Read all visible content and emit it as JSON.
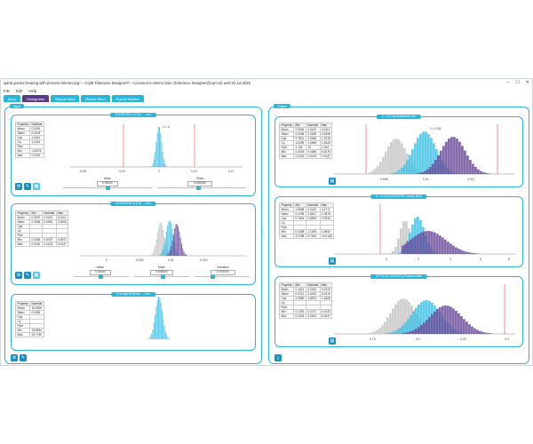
{
  "window": {
    "title": "spiral groove bearing with process tolerancing* – CQM Tolerance Designer® – Licensed to Demo User (Tolerance Designer@cqm.nl) until 31-12-2025",
    "controls": [
      "–",
      "☐",
      "✕"
    ]
  },
  "menu": [
    "File",
    "Edit",
    "Help"
  ],
  "tabs": [
    {
      "label": "Input",
      "active": false
    },
    {
      "label": "Histograms",
      "active": true
    },
    {
      "label": "Report Base",
      "active": false
    },
    {
      "label": "Report Elem",
      "active": false
    },
    {
      "label": "Export Studies",
      "active": false
    }
  ],
  "left": {
    "tag": "Input",
    "cards": [
      {
        "title": "ECCENTRIC (CTQ) ..... mm",
        "table": {
          "headers": [
            "Property",
            "Nominal"
          ],
          "rows": [
            [
              "Mean",
              "0.0000"
            ],
            [
              "Stdev",
              "0.0003"
            ],
            [
              "Cpk",
              "1.0411"
            ],
            [
              "Cp",
              "1.0421"
            ],
            [
              "Ppm",
              ""
            ],
            [
              "Min",
              "-0.0078"
            ],
            [
              "Max",
              "0.0024"
            ]
          ]
        },
        "ticks": [
          "-0.08",
          "-0.04",
          "0",
          "0.04",
          "0.11"
        ],
        "marker": "1 × σ",
        "sliders": [
          {
            "label": "Mean",
            "value": "0.00000"
          },
          {
            "label": "Stdev",
            "value": "0.000080"
          }
        ]
      },
      {
        "title": "ECCENTRIC B (TS) .... mm",
        "table": {
          "headers": [
            "Property",
            "Min",
            "Nominal",
            "Max"
          ],
          "rows": [
            [
              "Mean",
              "0.0097",
              "0.0100",
              "0.0111"
            ],
            [
              "Stdev",
              "0.0006",
              "0.0006",
              "0.0006"
            ],
            [
              "Cpk",
              "",
              "",
              ""
            ],
            [
              "Cp",
              "",
              "",
              ""
            ],
            [
              "Ppm",
              "",
              "",
              ""
            ],
            [
              "Min",
              "0.0053",
              "0.0075",
              "0.0097"
            ],
            [
              "Max",
              "0.0118",
              "0.0125",
              "0.0137"
            ]
          ]
        },
        "ticks": [
          "0",
          "0.005",
          "0.01",
          "0.015"
        ],
        "sliders": [
          {
            "label": "Mean",
            "value": "0.01000"
          },
          {
            "label": "Stdev",
            "value": "0.000600"
          },
          {
            "label": "Deviation",
            "value": "0.001000"
          }
        ]
      },
      {
        "title": "D (length B) (Max) ..... mm",
        "table": {
          "headers": [
            "Property",
            "Nominal"
          ],
          "rows": [
            [
              "Mean",
              "16.0000"
            ],
            [
              "Stdev",
              "0.0250"
            ],
            [
              "Cpk",
              ""
            ],
            [
              "Cp",
              ""
            ],
            [
              "Ppm",
              ""
            ],
            [
              "Min",
              "15.8934"
            ],
            [
              "Max",
              "16.7745"
            ]
          ]
        }
      }
    ]
  },
  "right": {
    "tag": "Output",
    "cards": [
      {
        "title": "Z = B (Gap dimension) mm",
        "marker": "1 × 0.05",
        "table": {
          "headers": [
            "Property",
            "Min",
            "Nominal",
            "Max"
          ],
          "rows": [
            [
              "Mean",
              "0.0082",
              "0.0100",
              "0.0113"
            ],
            [
              "Stdev",
              "0.0008",
              "0.0008",
              "0.0008"
            ],
            [
              "Cpk",
              "0.7811",
              "1.0468",
              "1.7615"
            ],
            [
              "Cp",
              "1.0035",
              "1.0998",
              "1.0540"
            ],
            [
              "Ppm",
              "1.134",
              "15",
              "1.044"
            ],
            [
              "Min",
              "0.0049",
              "0.0068",
              "0.0076"
            ],
            [
              "Max",
              "0.0115",
              "0.0133",
              "0.0147"
            ]
          ]
        },
        "ticks": [
          "0.008",
          "0.01",
          "0.012"
        ]
      },
      {
        "title": "D = B (D) ECCENTRIC (Outer) Bore",
        "table": {
          "headers": [
            "Property",
            "Min",
            "Nominal",
            "Max"
          ],
          "rows": [
            [
              "Mean",
              "1.8658",
              "2.0220",
              "4.2717"
            ],
            [
              "Stdev",
              "0.4798",
              "0.5617",
              "1.0878"
            ],
            [
              "Cpk",
              "0.7691",
              "0.8094",
              "0.7815"
            ],
            [
              "Cp",
              "",
              "",
              ""
            ],
            [
              "Ppm",
              "",
              "",
              ""
            ],
            [
              "Min",
              "0.4158",
              "1.1005",
              "1.8040"
            ],
            [
              "Max",
              "3.2788",
              "8.7054",
              "15.0138"
            ]
          ]
        },
        "ticks": [
          "0",
          "2",
          "4",
          "6",
          "8"
        ]
      },
      {
        "title": "LIFT B (ECCENTRIC) Process Mean",
        "table": {
          "headers": [
            "Property",
            "Min",
            "Nominal",
            "Max"
          ],
          "rows": [
            [
              "Mean",
              "0.1614",
              "0.2040",
              "0.2242"
            ],
            [
              "Stdev",
              "0.0212",
              "0.0214",
              "0.0216"
            ],
            [
              "Cpk",
              "2.9560",
              "1.8574",
              "1.1828"
            ],
            [
              "Cp",
              "",
              "",
              ""
            ],
            [
              "Ppm",
              "",
              "",
              ""
            ],
            [
              "Min",
              "0.1252",
              "0.1172",
              "0.1033"
            ],
            [
              "Max",
              "0.2318",
              "0.2524",
              "0.2637"
            ]
          ]
        },
        "ticks": [
          "0.15",
          "0.2",
          "0.25",
          "0.3"
        ]
      }
    ]
  },
  "colors": {
    "accent": "#29b6d9",
    "tab_active": "#5a3a8a",
    "gray_series": "#c8c8c8",
    "cyan_series": "#3fc1e6",
    "purple_series": "#6a4a9a",
    "spec_line": "#e05050"
  },
  "icons": {
    "settings": "gear-icon",
    "chart": "chart-icon",
    "export": "export-icon",
    "expand": "expand-icon"
  }
}
